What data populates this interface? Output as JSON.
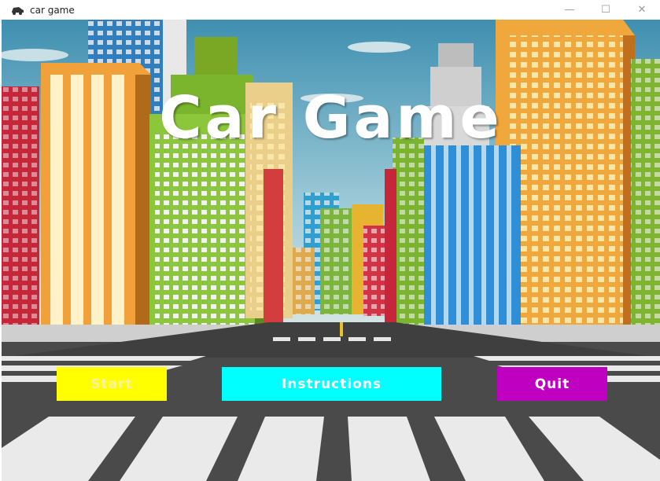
{
  "window": {
    "title": "car game",
    "icon": "car-icon",
    "controls": {
      "minimize": "—",
      "maximize": "☐",
      "close": "✕"
    }
  },
  "game": {
    "title": "Car Game",
    "buttons": {
      "start": {
        "label": "Start",
        "color": "#ffff00"
      },
      "instructions": {
        "label": "Instructions",
        "color": "#00ffff"
      },
      "quit": {
        "label": "Quit",
        "color": "#c000c0"
      }
    }
  }
}
